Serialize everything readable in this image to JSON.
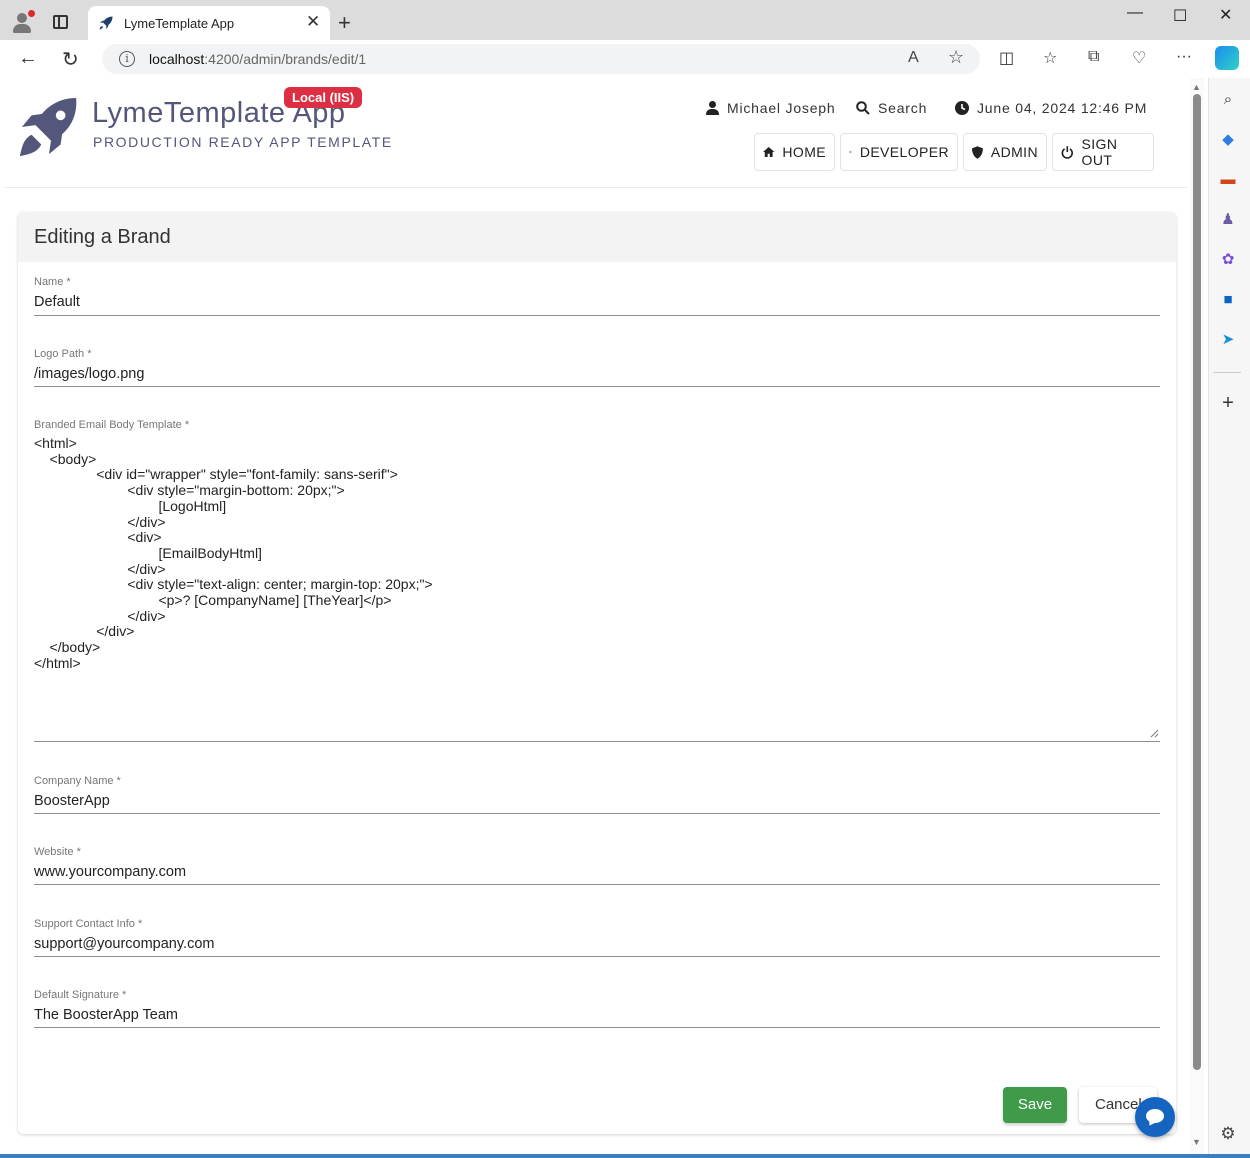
{
  "browser": {
    "tab_title": "LymeTemplate App",
    "url_host": "localhost",
    "url_path": ":4200/admin/brands/edit/1"
  },
  "header": {
    "app_name": "LymeTemplate App",
    "env_badge": "Local (IIS)",
    "subtitle": "PRODUCTION READY APP TEMPLATE",
    "user_name": "Michael Joseph",
    "search_label": "Search",
    "datetime": "June 04, 2024 12:46 PM",
    "nav": {
      "home": "HOME",
      "developer": "DEVELOPER",
      "admin": "ADMIN",
      "sign_out": "SIGN OUT"
    }
  },
  "form": {
    "title": "Editing a Brand",
    "name_label": "Name *",
    "name_value": "Default",
    "logo_label": "Logo Path *",
    "logo_value": "/images/logo.png",
    "template_label": "Branded Email Body Template *",
    "template_value": "<html>\n    <body>\n                <div id=\"wrapper\" style=\"font-family: sans-serif\">\n                        <div style=\"margin-bottom: 20px;\">\n                                [LogoHtml]\n                        </div>\n                        <div>\n                                [EmailBodyHtml]\n                        </div>\n                        <div style=\"text-align: center; margin-top: 20px;\">\n                                <p>? [CompanyName] [TheYear]</p>\n                        </div>\n                </div>\n    </body>\n</html>",
    "company_label": "Company Name *",
    "company_value": "BoosterApp",
    "website_label": "Website *",
    "website_value": "www.yourcompany.com",
    "support_label": "Support Contact Info *",
    "support_value": "support@yourcompany.com",
    "signature_label": "Default Signature *",
    "signature_value": "The BoosterApp Team",
    "save_label": "Save",
    "cancel_label": "Cancel"
  },
  "colors": {
    "brand": "#53577b",
    "badge": "#dc2f43",
    "save": "#3f9a4a",
    "chat": "#1565c0"
  }
}
